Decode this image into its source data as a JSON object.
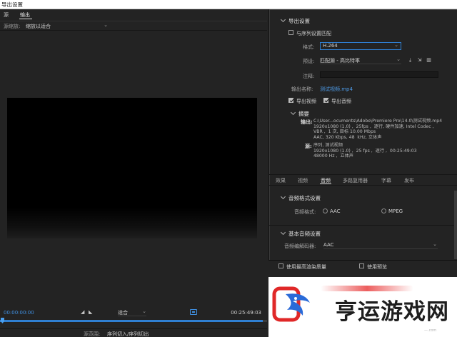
{
  "window": {
    "title": "导出设置"
  },
  "left": {
    "tabs": [
      {
        "label": "源"
      },
      {
        "label": "输出"
      }
    ],
    "source_scaling": {
      "label": "源缩放:",
      "value": "缩放以适合"
    },
    "timebar": {
      "current_time": "00:00:00:00",
      "end_time": "00:25:49:03",
      "fit": "适合"
    },
    "range": {
      "label": "源范围:",
      "value": "序列切入/序列切出"
    }
  },
  "export": {
    "heading": "导出设置",
    "match_sequence": {
      "label": "与序列设置匹配",
      "checked": false
    },
    "format": {
      "label": "格式:",
      "value": "H.264"
    },
    "preset": {
      "label": "预设:",
      "value": "匹配源 - 高比特率"
    },
    "comments": {
      "label": "注释:",
      "value": ""
    },
    "output_name": {
      "label": "输出名称:",
      "value": "测试视频.mp4"
    },
    "export_video": {
      "label": "导出视频",
      "checked": true
    },
    "export_audio": {
      "label": "导出音频",
      "checked": true
    }
  },
  "summary": {
    "heading": "摘要",
    "output_key": "输出:",
    "output_lines": [
      "C:\\User...ocuments\\Adobe\\Premiere Pro\\14.0\\测试视频.mp4",
      "1920x1080 (1.0) ,  25fps ,  逐行, 硬件加速, Intel Codec ,",
      "VBR ,  1 次, 目标 10.00 Mbps",
      "AAC, 320 Kbps, 48  kHz, 立体声"
    ],
    "source_key": "源:",
    "source_lines": [
      "序列, 测试视频",
      "1920x1080 (1.0) ,  25 fps ,  逐行 ,  00:25:49:03",
      "48000 Hz ,  立体声"
    ]
  },
  "tabs": [
    {
      "label": "效果"
    },
    {
      "label": "视频"
    },
    {
      "label": "音频"
    },
    {
      "label": "多路复用器"
    },
    {
      "label": "字幕"
    },
    {
      "label": "发布"
    }
  ],
  "audio_format": {
    "heading": "音频格式设置",
    "label": "音频格式:",
    "options": [
      {
        "label": "AAC"
      },
      {
        "label": "MPEG"
      }
    ]
  },
  "basic_audio": {
    "heading": "基本音频设置",
    "codec": {
      "label": "音频编解码器:",
      "value": "AAC"
    }
  },
  "bottom_options": [
    {
      "label": "使用最高渲染质量",
      "checked": false
    },
    {
      "label": "使用预览",
      "checked": false
    }
  ],
  "watermark": {
    "text": "亨运游戏网",
    "url": "—.com",
    "colors": {
      "red": "#e02828",
      "blue": "#2a6ad8"
    }
  },
  "colors": {
    "accent": "#2f7fd2",
    "link": "#4d9be8",
    "panel": "#232323"
  }
}
